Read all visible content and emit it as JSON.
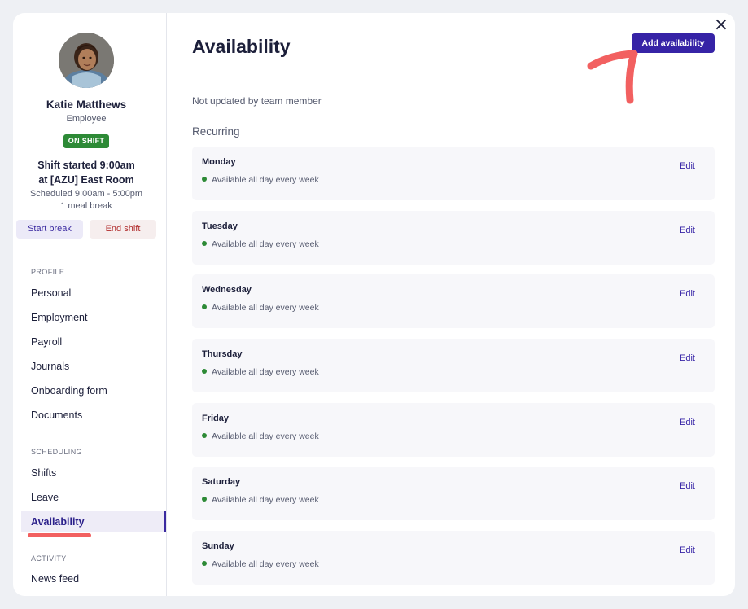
{
  "close_icon": "×",
  "profile": {
    "name": "Katie Matthews",
    "role": "Employee",
    "status_badge": "ON SHIFT",
    "shift_line1": "Shift started 9:00am",
    "shift_line2": "at [AZU] East Room",
    "scheduled": "Scheduled 9:00am - 5:00pm",
    "breaks": "1 meal break",
    "start_break_label": "Start break",
    "end_shift_label": "End shift"
  },
  "sidebar": {
    "profile_heading": "PROFILE",
    "profile_items": [
      "Personal",
      "Employment",
      "Payroll",
      "Journals",
      "Onboarding form",
      "Documents"
    ],
    "scheduling_heading": "SCHEDULING",
    "scheduling_items": [
      "Shifts",
      "Leave",
      "Availability"
    ],
    "activity_heading": "ACTIVITY",
    "activity_items": [
      "News feed"
    ],
    "active_item": "Availability"
  },
  "main": {
    "title": "Availability",
    "add_button_label": "Add availability",
    "update_note": "Not updated by team member",
    "recurring_heading": "Recurring",
    "days": [
      {
        "name": "Monday",
        "status": "Available all day every week",
        "edit_label": "Edit"
      },
      {
        "name": "Tuesday",
        "status": "Available all day every week",
        "edit_label": "Edit"
      },
      {
        "name": "Wednesday",
        "status": "Available all day every week",
        "edit_label": "Edit"
      },
      {
        "name": "Thursday",
        "status": "Available all day every week",
        "edit_label": "Edit"
      },
      {
        "name": "Friday",
        "status": "Available all day every week",
        "edit_label": "Edit"
      },
      {
        "name": "Saturday",
        "status": "Available all day every week",
        "edit_label": "Edit"
      },
      {
        "name": "Sunday",
        "status": "Available all day every week",
        "edit_label": "Edit"
      }
    ]
  },
  "colors": {
    "accent": "#3623a6",
    "on_shift": "#2d8a36",
    "annotation": "#f26060"
  }
}
